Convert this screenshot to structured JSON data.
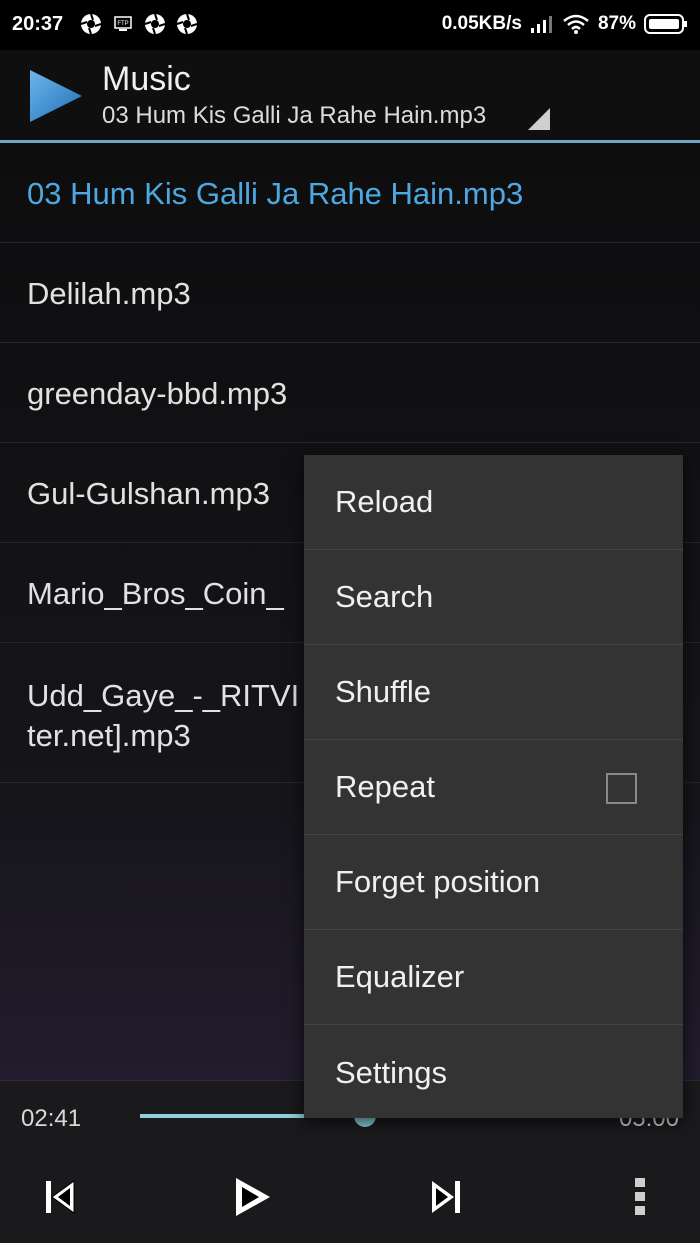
{
  "status_bar": {
    "time": "20:37",
    "network_speed": "0.05KB/s",
    "battery": "87%",
    "icons": [
      "aperture-icon",
      "ftp-icon",
      "aperture-icon",
      "aperture-icon",
      "signal-icon",
      "wifi-icon",
      "battery-icon"
    ]
  },
  "app_bar": {
    "title": "Music",
    "subtitle": "03 Hum Kis Galli Ja Rahe Hain.mp3",
    "icon": "play-logo-icon"
  },
  "playlist": {
    "items": [
      {
        "lines": [
          "03 Hum Kis Galli Ja Rahe Hain.mp3",
          ""
        ],
        "active": true
      },
      {
        "lines": [
          "Delilah.mp3",
          ""
        ],
        "active": false
      },
      {
        "lines": [
          "greenday-bbd.mp3",
          ""
        ],
        "active": false
      },
      {
        "lines": [
          "Gul-Gulshan.mp3",
          ""
        ],
        "active": false
      },
      {
        "lines": [
          "Mario_Bros_Coin_",
          ""
        ],
        "active": false
      },
      {
        "lines": [
          "Udd_Gaye_-_RITVI",
          "ter.net].mp3"
        ],
        "active": false
      }
    ]
  },
  "player": {
    "current_time": "02:41",
    "total_time": "05:00",
    "progress": 0.5,
    "controls": [
      "previous-icon",
      "play-icon",
      "next-icon",
      "overflow-menu-icon"
    ]
  },
  "menu": {
    "items": [
      {
        "label": "Reload"
      },
      {
        "label": "Search"
      },
      {
        "label": "Shuffle"
      },
      {
        "label": "Repeat",
        "checkbox": false
      },
      {
        "label": "Forget position"
      },
      {
        "label": "Equalizer"
      },
      {
        "label": "Settings"
      }
    ]
  },
  "colors": {
    "accent": "#4da8e2",
    "seek": "#8fd0da",
    "menu_bg": "#333333"
  }
}
